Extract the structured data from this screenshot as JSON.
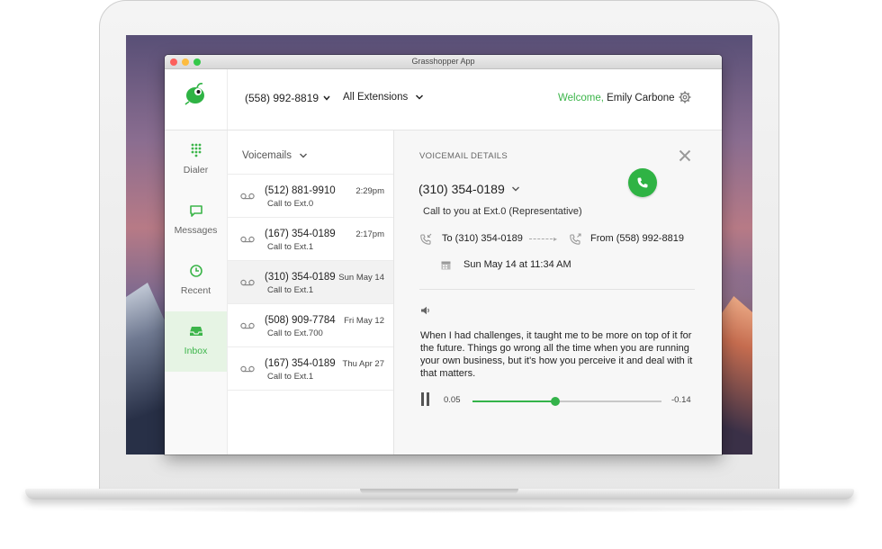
{
  "window": {
    "title": "Grasshopper App"
  },
  "header": {
    "phone_number": "(558) 992-8819",
    "extensions_label": "All Extensions",
    "welcome_prefix": "Welcome,",
    "user_name": "Emily Carbone"
  },
  "sidebar": {
    "items": [
      {
        "label": "Dialer",
        "icon": "dialpad-icon"
      },
      {
        "label": "Messages",
        "icon": "message-icon"
      },
      {
        "label": "Recent",
        "icon": "clock-icon"
      },
      {
        "label": "Inbox",
        "icon": "inbox-icon",
        "active": true
      }
    ]
  },
  "voicemails": {
    "title": "Voicemails",
    "items": [
      {
        "number": "(512) 881-9910",
        "sub": "Call to Ext.0",
        "time": "2:29pm"
      },
      {
        "number": "(167) 354-0189",
        "sub": "Call to Ext.1",
        "time": "2:17pm"
      },
      {
        "number": "(310) 354-0189",
        "sub": "Call to Ext.1",
        "time": "Sun May 14",
        "selected": true
      },
      {
        "number": "(508) 909-7784",
        "sub": "Call to Ext.700",
        "time": "Fri May 12"
      },
      {
        "number": "(167) 354-0189",
        "sub": "Call to Ext.1",
        "time": "Thu Apr 27"
      }
    ]
  },
  "details": {
    "title": "VOICEMAIL DETAILS",
    "number": "(310) 354-0189",
    "call_to": "Call to you at Ext.0 (Representative)",
    "to": "To (310) 354-0189",
    "from": "From (558) 992-8819",
    "date": "Sun May 14 at 11:34 AM",
    "transcript": "When I had challenges, it taught me to be more on top of it for the future. Things go wrong all the time when you are running your own business, but it's how you perceive it and deal with it that matters.",
    "player": {
      "current": "0.05",
      "remaining": "-0.14",
      "progress": 0.44
    }
  },
  "colors": {
    "accent": "#3cb54a",
    "call_button": "#2fb344"
  }
}
